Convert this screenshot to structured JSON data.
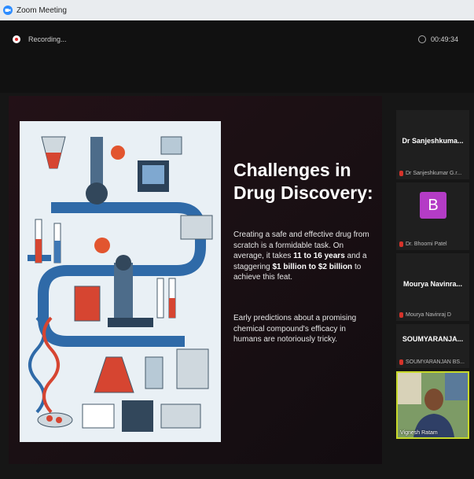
{
  "window": {
    "title": "Zoom Meeting"
  },
  "toolbar": {
    "recording_label": "Recording...",
    "timer": "00:49:34"
  },
  "slide": {
    "heading_line1": "Challenges in",
    "heading_line2": "Drug Discovery:",
    "para1_a": "Creating a safe and effective drug from scratch is a formidable task. On average, it takes ",
    "para1_b": "11 to 16 years",
    "para1_c": " and a staggering ",
    "para1_d": "$1 billion to $2 billion",
    "para1_e": " to achieve this feat.",
    "para2": "Early predictions about a promising chemical compound's efficacy in humans are notoriously tricky."
  },
  "participants": [
    {
      "display": "Dr Sanjeshkuma...",
      "name": "Dr Sanjeshkumar G.r..."
    },
    {
      "avatar_letter": "B",
      "name": "Dr. Bhoomi Patel"
    },
    {
      "display": "Mourya Navinra...",
      "name": "Mourya Navinraj D"
    },
    {
      "display": "SOUMYARANJA...",
      "name": "SOUMYARANJAN BS..."
    },
    {
      "name": "Vignesh Ratam"
    }
  ]
}
